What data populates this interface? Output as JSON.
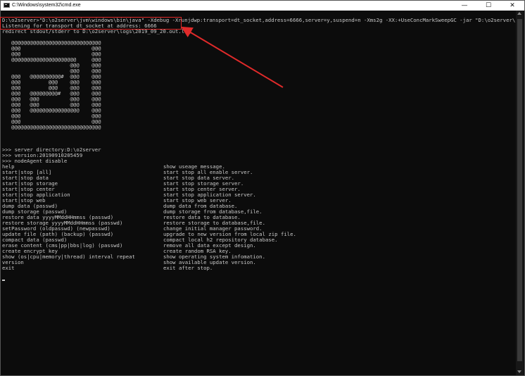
{
  "window": {
    "title": "C:\\Windows\\system32\\cmd.exe",
    "minimize_glyph": "—",
    "maximize_glyph": "☐",
    "close_glyph": "✕"
  },
  "console": {
    "command": "D:\\o2server>\"D:\\o2server\\jvm\\windows\\bin\\java\" -Xdebug -Xrunjdwp:transport=dt_socket,address=6666,server=y,suspend=n -Xms2g -XX:+UseConcMarkSweepGC -jar \"D:\\o2server\\console.jar\"",
    "listening": "Listening for transport dt_socket at address: 6666",
    "redirect": "redirect stdout/stderr to D:\\o2server\\logs\\2019_09_20.out.log",
    "banner": [
      "@@@@@@@@@@@@@@@@@@@@@@@@@@@@@",
      "@@@                       @@@",
      "@@@                       @@@",
      "@@@@@@@@@@@@@@@@@@@@@     @@@",
      "                   @@@    @@@",
      "                   @@@    @@@",
      "@@@   @@@@@@@@@@#  @@@    @@@",
      "@@@         @@@    @@@    @@@",
      "@@@         @@@    @@@    @@@",
      "@@@   @@@@@@@@@#   @@@    @@@",
      "@@@   @@@          @@@    @@@",
      "@@@   @@@          @@@    @@@",
      "@@@   @@@@@@@@@@@@@@@@    @@@",
      "@@@                       @@@",
      "@@@                       @@@",
      "@@@@@@@@@@@@@@@@@@@@@@@@@@@@@"
    ],
    "server_directory": ">>> server directory:D:\\o2server",
    "version": ">>> version:20190910205459",
    "node_agent": ">>> nodeAgent disable",
    "help": [
      [
        "help",
        "show useage message."
      ],
      [
        "start|stop [all]",
        "start stop all enable server."
      ],
      [
        "start|stop data",
        "start stop data server."
      ],
      [
        "start|stop storage",
        "start stop storage server."
      ],
      [
        "start|stop center",
        "start stop center server."
      ],
      [
        "start|stop application",
        "start stop application server."
      ],
      [
        "start|stop web",
        "start stop web server."
      ],
      [
        "dump data (passwd)",
        "dump data from database."
      ],
      [
        "dump storage (passwd)",
        "dump storage from database,file."
      ],
      [
        "restore data yyyyMMddHHmmss (passwd)",
        "restore data to database."
      ],
      [
        "restore storage yyyyMMddHHmmss (passwd)",
        "restore storage to database,file."
      ],
      [
        "setPassword (oldpasswd) (newpasswd)",
        "change initial manager password."
      ],
      [
        "update file (path) (backup) (passwd)",
        "upgrade to new version from local zip file."
      ],
      [
        "compact data (passwd)",
        "compact local h2 repository database."
      ],
      [
        "erase content (cms|pp|bbs|log) (passwd)",
        "remove all data except design."
      ],
      [
        "create encrypt key",
        "create random RSA key."
      ],
      [
        "show (os|cpu|memory|thread) interval repeat",
        "show operating system infomation."
      ],
      [
        "version",
        "show available update version."
      ],
      [
        "exit",
        "exit after stop."
      ]
    ]
  },
  "annotation_color": "#e02a2a"
}
